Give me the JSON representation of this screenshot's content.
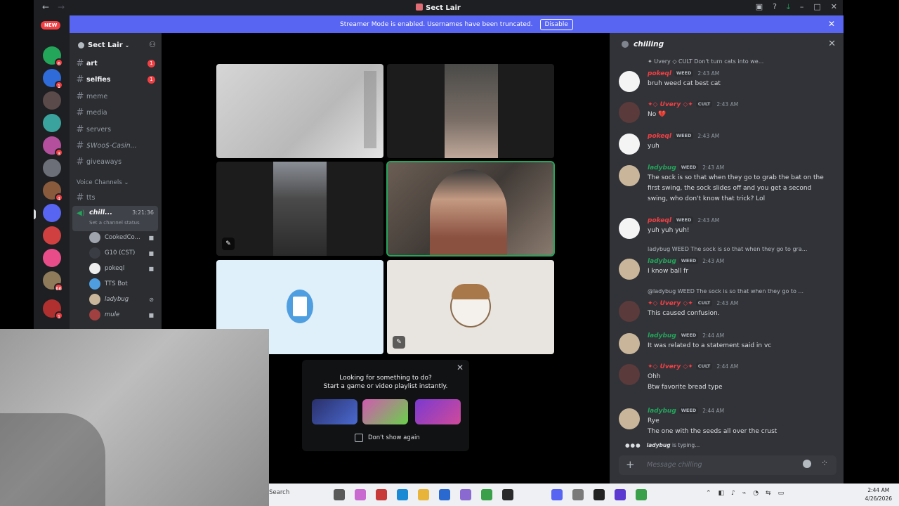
{
  "window": {
    "title": "Sect Lair"
  },
  "banner": {
    "text": "Streamer Mode is enabled. Usernames have been truncated.",
    "button": "Disable"
  },
  "rail": {
    "new_label": "NEW"
  },
  "guild": {
    "name": "Sect Lair"
  },
  "channels": [
    {
      "name": "art",
      "unread": true,
      "badge": "1"
    },
    {
      "name": "selfies",
      "unread": true,
      "badge": "1"
    },
    {
      "name": "meme",
      "unread": false,
      "badge": ""
    },
    {
      "name": "media",
      "unread": false,
      "badge": ""
    },
    {
      "name": "servers",
      "unread": false,
      "badge": ""
    },
    {
      "name": "$Woo$-Casin...",
      "unread": false,
      "badge": ""
    },
    {
      "name": "giveaways",
      "unread": false,
      "badge": ""
    }
  ],
  "voice": {
    "category": "Voice Channels",
    "tts": "tts",
    "active_channel": "chill...",
    "duration": "3:21:36",
    "status_hint": "Set a channel status",
    "users": [
      "CookedCo...",
      "G10 (CST)",
      "pokeql",
      "TTS Bot",
      "ladybug",
      "mule"
    ]
  },
  "suggest": {
    "line1": "Looking for something to do?",
    "line2": "Start a game or video playlist instantly.",
    "checkbox_label": "Don't show again"
  },
  "chat": {
    "channel": "chilling",
    "messages": [
      {
        "reply": "✦ Uvery ◇ CULT  Don't turn cats into we...",
        "user": "pokeql",
        "tag": "WEED",
        "color": "#f23f43",
        "time": "2:43 AM",
        "body": "bruh weed cat best cat"
      },
      {
        "user": "✦◇ Uvery ◇✦",
        "tag": "CULT",
        "color": "#f23f43",
        "time": "2:43 AM",
        "body": "No 💔"
      },
      {
        "user": "pokeql",
        "tag": "WEED",
        "color": "#f23f43",
        "time": "2:43 AM",
        "body": "yuh"
      },
      {
        "user": "ladybug",
        "tag": "WEED",
        "color": "#23a55a",
        "time": "2:43 AM",
        "body": "The sock is so that when they go to grab the bat on the first swing, the sock slides off and you get a second swing, who don't know that trick? Lol"
      },
      {
        "user": "pokeql",
        "tag": "WEED",
        "color": "#f23f43",
        "time": "2:43 AM",
        "body": "yuh yuh yuh!"
      },
      {
        "reply": "ladybug  WEED  The sock is so that when they go to gra...",
        "user": "ladybug",
        "tag": "WEED",
        "color": "#23a55a",
        "time": "2:43 AM",
        "body": "I know ball fr"
      },
      {
        "reply": "@ladybug  WEED  The sock is so that when they go to ...",
        "user": "✦◇ Uvery ◇✦",
        "tag": "CULT",
        "color": "#f23f43",
        "time": "2:43 AM",
        "body": "This caused confusion."
      },
      {
        "user": "ladybug",
        "tag": "WEED",
        "color": "#23a55a",
        "time": "2:44 AM",
        "body": "It was related to a statement said in vc"
      },
      {
        "user": "✦◇ Uvery ◇✦",
        "tag": "CULT",
        "color": "#f23f43",
        "time": "2:44 AM",
        "body": "Ohh\nBtw favorite bread type"
      },
      {
        "user": "ladybug",
        "tag": "WEED",
        "color": "#23a55a",
        "time": "2:44 AM",
        "body": "Rye\nThe one with the seeds all over the crust"
      }
    ],
    "typing_user": "ladybug",
    "typing_suffix": "is typing...",
    "placeholder": "Message chilling"
  },
  "taskbar": {
    "search": "Search",
    "time": "2:44 AM",
    "date": "4/26/2026"
  }
}
